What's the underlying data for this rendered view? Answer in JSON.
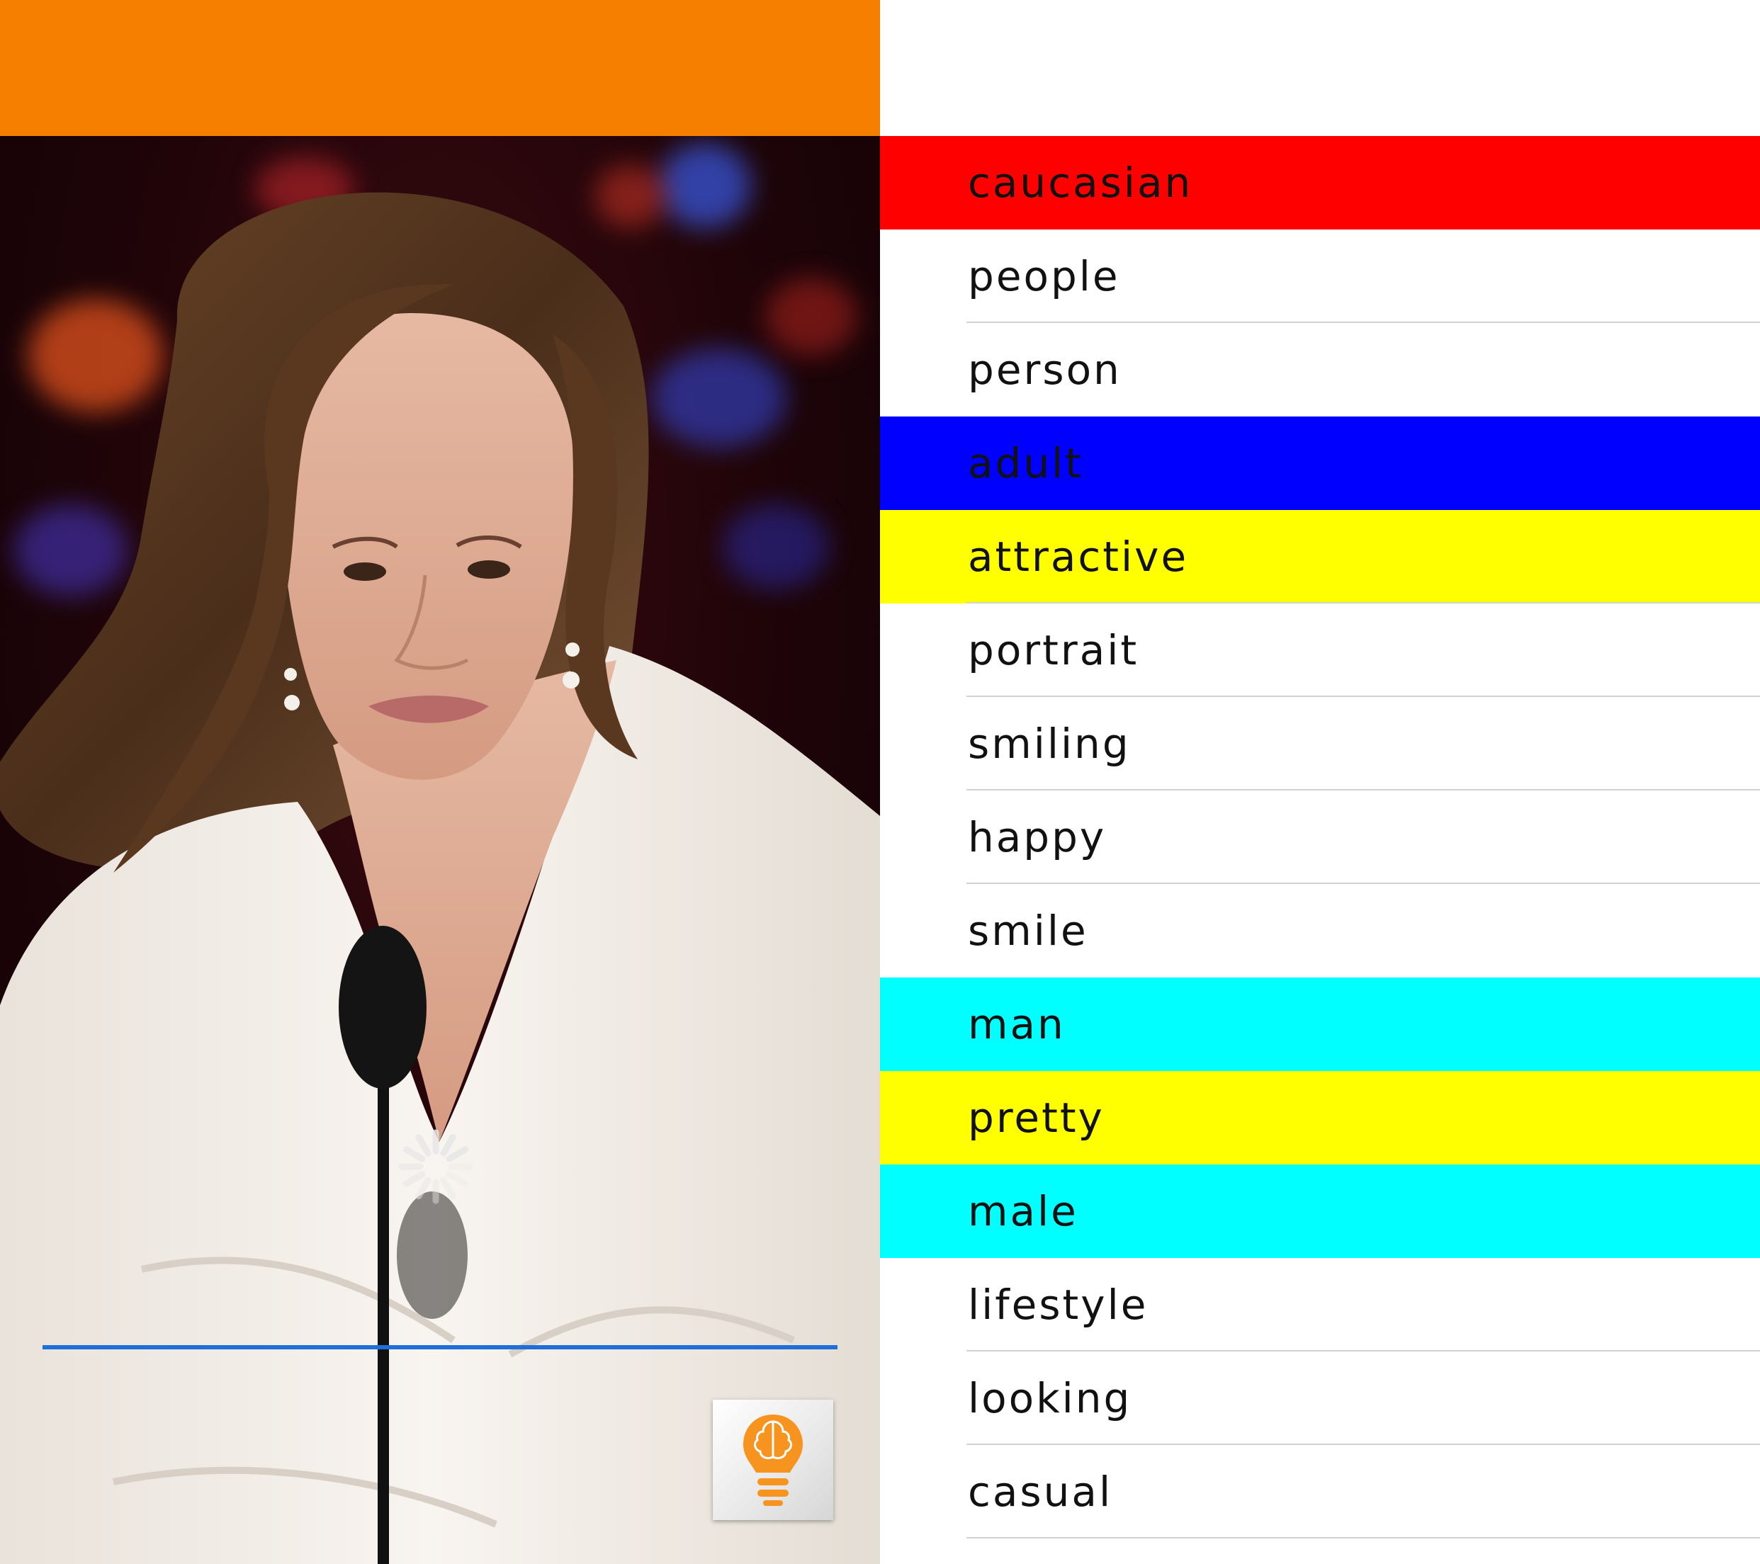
{
  "colors": {
    "topbar": "#f77f00",
    "progress_line": "#1e6fd9",
    "spinner": "#e8e8e8",
    "logo_orange": "#f79420",
    "highlight_red": "#ff0000",
    "highlight_blue": "#0000ff",
    "highlight_yellow": "#ffff00",
    "highlight_cyan": "#00ffff",
    "row_plain": "#ffffff"
  },
  "photo": {
    "description_icon": "photo-of-speaker-at-microphone"
  },
  "logo": {
    "icon": "lightbulb-brain-icon"
  },
  "tags": [
    {
      "label": "caucasian",
      "highlight": "#ff0000",
      "divider": false
    },
    {
      "label": "people",
      "highlight": "#ffffff",
      "divider": true
    },
    {
      "label": "person",
      "highlight": "#ffffff",
      "divider": false
    },
    {
      "label": "adult",
      "highlight": "#0000ff",
      "divider": false
    },
    {
      "label": "attractive",
      "highlight": "#ffff00",
      "divider": true
    },
    {
      "label": "portrait",
      "highlight": "#ffffff",
      "divider": true
    },
    {
      "label": "smiling",
      "highlight": "#ffffff",
      "divider": true
    },
    {
      "label": "happy",
      "highlight": "#ffffff",
      "divider": true
    },
    {
      "label": "smile",
      "highlight": "#ffffff",
      "divider": false
    },
    {
      "label": "man",
      "highlight": "#00ffff",
      "divider": false
    },
    {
      "label": "pretty",
      "highlight": "#ffff00",
      "divider": false
    },
    {
      "label": "male",
      "highlight": "#00ffff",
      "divider": false
    },
    {
      "label": "lifestyle",
      "highlight": "#ffffff",
      "divider": true
    },
    {
      "label": "looking",
      "highlight": "#ffffff",
      "divider": true
    },
    {
      "label": "casual",
      "highlight": "#ffffff",
      "divider": true
    }
  ]
}
